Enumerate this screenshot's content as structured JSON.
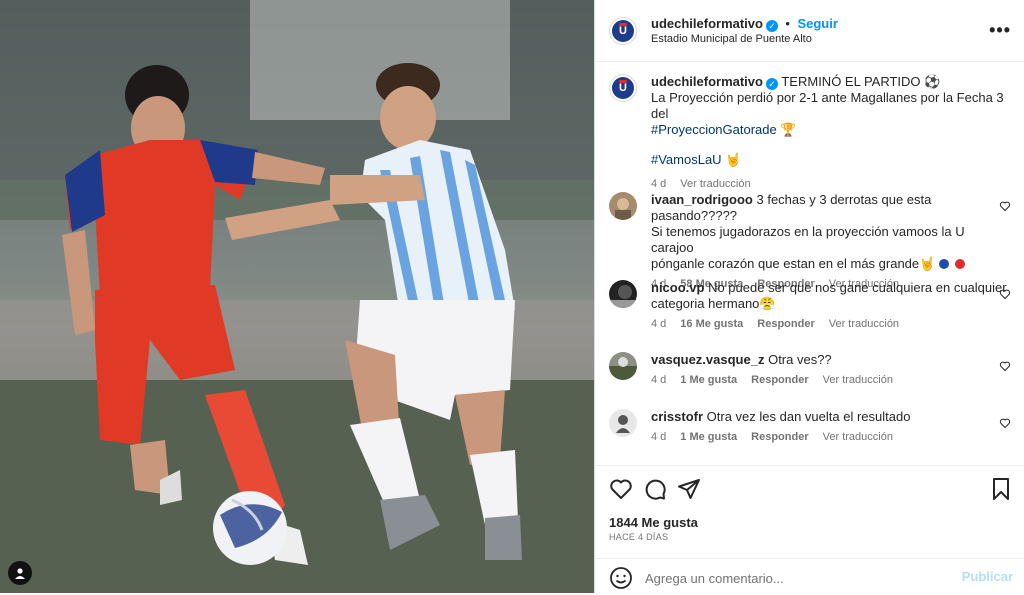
{
  "post": {
    "username": "udechileformativo",
    "follow_label": "Seguir",
    "location": "Estadio Municipal de Puente Alto",
    "more_label": "•••",
    "caption": {
      "username": "udechileformativo",
      "text_line1": "TERMINÓ EL PARTIDO ⚽",
      "text_line2": "La Proyección perdió por 2-1 ante Magallanes por la Fecha 3 del",
      "hashtag1": "#ProyeccionGatorade",
      "emoji1": "🏆",
      "hashtag2": "#VamosLaU",
      "emoji2": "🤘",
      "time": "4 d",
      "translate": "Ver traducción"
    }
  },
  "comments": [
    {
      "username": "ivaan_rodrigooo",
      "text1": "3 fechas y 3 derrotas que esta pasando?????",
      "text2": "Si tenemos jugadorazos en la proyección vamoos la U carajoo",
      "text3": "pónganle corazón que estan en el más grande🤘",
      "time": "4 d",
      "likes": "58 Me gusta",
      "reply": "Responder",
      "translate": "Ver traducción"
    },
    {
      "username": "nicoo.vp",
      "text1": "No puede ser que nos gane cualquiera en cualquier",
      "text2": "categoria hermano😤",
      "time": "4 d",
      "likes": "16 Me gusta",
      "reply": "Responder",
      "translate": "Ver traducción"
    },
    {
      "username": "vasquez.vasque_z",
      "text1": "Otra ves??",
      "time": "4 d",
      "likes": "1 Me gusta",
      "reply": "Responder",
      "translate": "Ver traducción"
    },
    {
      "username": "crisstofr",
      "text1": "Otra vez les dan vuelta el resultado",
      "time": "4 d",
      "likes": "1 Me gusta",
      "reply": "Responder",
      "translate": "Ver traducción"
    }
  ],
  "footer": {
    "likes": "1844 Me gusta",
    "date": "HACE 4 DÍAS",
    "comment_placeholder": "Agrega un comentario...",
    "publish_label": "Publicar"
  },
  "colors": {
    "accent": "#0095f6",
    "hashtag": "#00376b",
    "muted": "#737373"
  },
  "icons": [
    "heart-icon",
    "comment-icon",
    "share-icon",
    "bookmark-icon",
    "emoji-icon",
    "verified-icon",
    "more-icon",
    "user-tag-icon"
  ]
}
